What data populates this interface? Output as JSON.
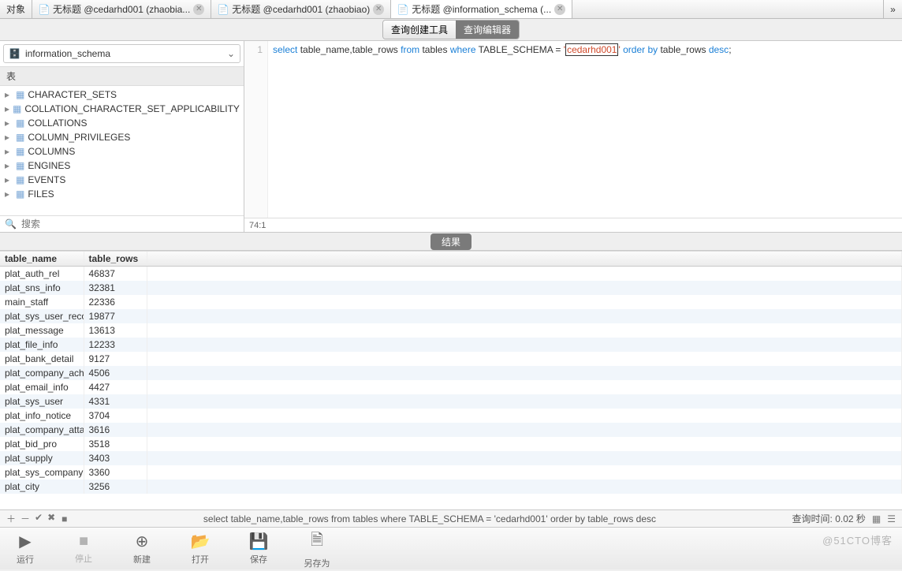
{
  "tabs": [
    {
      "label": "对象",
      "icon": "table-icon",
      "closable": false
    },
    {
      "label": "无标题 @cedarhd001 (zhaobia...",
      "icon": "query-icon",
      "closable": true
    },
    {
      "label": "无标题 @cedarhd001 (zhaobiao)",
      "icon": "query-icon",
      "closable": true
    },
    {
      "label": "无标题 @information_schema (...",
      "icon": "query-icon",
      "closable": true,
      "active": true
    }
  ],
  "overflow_glyph": "»",
  "seg_buttons": {
    "builder": "查询创建工具",
    "editor": "查询编辑器"
  },
  "schema": {
    "name": "information_schema"
  },
  "side_header": "表",
  "tree_items": [
    "CHARACTER_SETS",
    "COLLATION_CHARACTER_SET_APPLICABILITY",
    "COLLATIONS",
    "COLUMN_PRIVILEGES",
    "COLUMNS",
    "ENGINES",
    "EVENTS",
    "FILES"
  ],
  "search_placeholder": "搜索",
  "sql": {
    "line_no": "1",
    "tokens": {
      "select": "select",
      "cols": " table_name,table_rows ",
      "from": "from",
      "tables": " tables ",
      "where": "where",
      "schema_col": " TABLE_SCHEMA = ",
      "q1": "'",
      "val": "cedarhd001",
      "q2": "'",
      "order_by": " order by",
      "rest": " table_rows ",
      "desc": "desc",
      "semi": ";"
    },
    "cursor_pos": "74:1"
  },
  "result_label": "结果",
  "columns": [
    "table_name",
    "table_rows"
  ],
  "rows": [
    {
      "table_name": "plat_auth_rel",
      "table_rows": "46837"
    },
    {
      "table_name": "plat_sns_info",
      "table_rows": "32381"
    },
    {
      "table_name": "main_staff",
      "table_rows": "22336"
    },
    {
      "table_name": "plat_sys_user_reco",
      "table_rows": "19877"
    },
    {
      "table_name": "plat_message",
      "table_rows": "13613"
    },
    {
      "table_name": "plat_file_info",
      "table_rows": "12233"
    },
    {
      "table_name": "plat_bank_detail",
      "table_rows": "9127"
    },
    {
      "table_name": "plat_company_ach",
      "table_rows": "4506"
    },
    {
      "table_name": "plat_email_info",
      "table_rows": "4427"
    },
    {
      "table_name": "plat_sys_user",
      "table_rows": "4331"
    },
    {
      "table_name": "plat_info_notice",
      "table_rows": "3704"
    },
    {
      "table_name": "plat_company_atta",
      "table_rows": "3616"
    },
    {
      "table_name": "plat_bid_pro",
      "table_rows": "3518"
    },
    {
      "table_name": "plat_supply",
      "table_rows": "3403"
    },
    {
      "table_name": "plat_sys_company",
      "table_rows": "3360"
    },
    {
      "table_name": "plat_city",
      "table_rows": "3256"
    }
  ],
  "status": {
    "sql_text": "select table_name,table_rows from tables where TABLE_SCHEMA = 'cedarhd001' order by table_rows desc",
    "timing": "查询时间: 0.02 秒"
  },
  "bottom_buttons": {
    "run": "运行",
    "stop": "停止",
    "new": "新建",
    "open": "打开",
    "save": "保存",
    "save_as": "另存为"
  },
  "watermark": "@51CTO博客"
}
